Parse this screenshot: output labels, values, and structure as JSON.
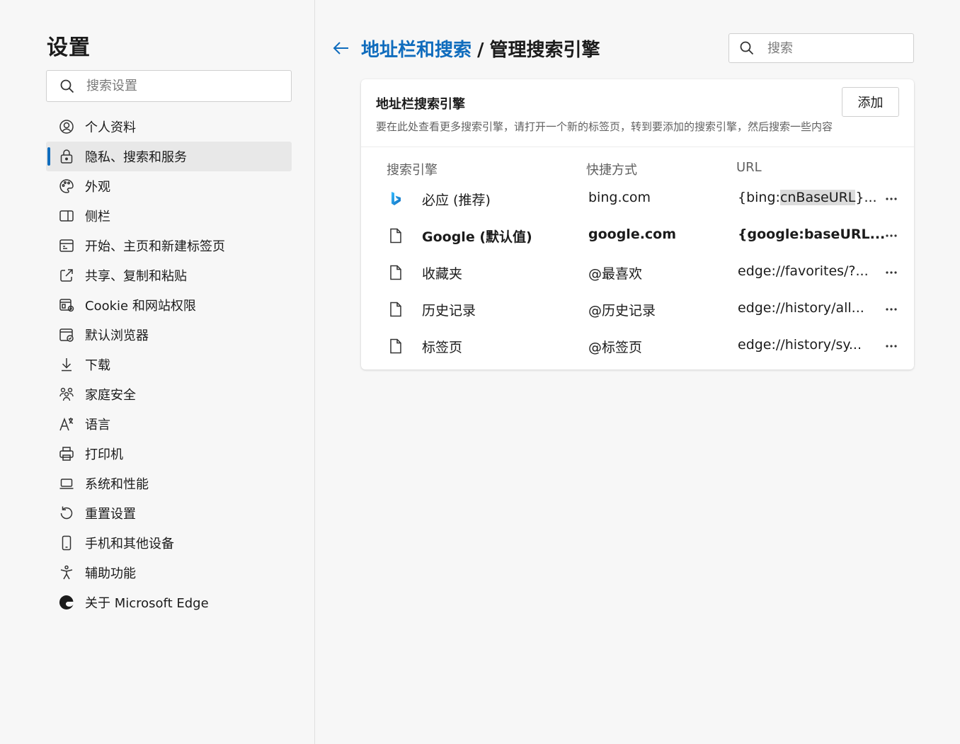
{
  "sidebar": {
    "title": "设置",
    "search_placeholder": "搜索设置",
    "items": [
      {
        "label": "个人资料"
      },
      {
        "label": "隐私、搜索和服务"
      },
      {
        "label": "外观"
      },
      {
        "label": "侧栏"
      },
      {
        "label": "开始、主页和新建标签页"
      },
      {
        "label": "共享、复制和粘贴"
      },
      {
        "label": "Cookie 和网站权限"
      },
      {
        "label": "默认浏览器"
      },
      {
        "label": "下载"
      },
      {
        "label": "家庭安全"
      },
      {
        "label": "语言"
      },
      {
        "label": "打印机"
      },
      {
        "label": "系统和性能"
      },
      {
        "label": "重置设置"
      },
      {
        "label": "手机和其他设备"
      },
      {
        "label": "辅助功能"
      },
      {
        "label": "关于 Microsoft Edge"
      }
    ],
    "active_index": 1
  },
  "header": {
    "breadcrumb_link": "地址栏和搜索",
    "separator": "/",
    "breadcrumb_current": "管理搜索引擎",
    "search_placeholder": "搜索"
  },
  "card": {
    "title": "地址栏搜索引擎",
    "description": "要在此处查看更多搜索引擎，请打开一个新的标签页，转到要添加的搜索引擎，然后搜索一些内容",
    "add_label": "添加",
    "columns": {
      "engine": "搜索引擎",
      "shortcut": "快捷方式",
      "url": "URL"
    },
    "rows": [
      {
        "name": "必应 (推荐)",
        "shortcut": "bing.com",
        "url_pre": "{bing:",
        "url_hl": "cnBaseURL",
        "url_post": "}...",
        "icon": "bing-icon",
        "bold": false
      },
      {
        "name": "Google (默认值)",
        "shortcut": "google.com",
        "url_pre": "{google:baseURL...",
        "url_hl": "",
        "url_post": "",
        "icon": "page-icon",
        "bold": true
      },
      {
        "name": "收藏夹",
        "shortcut": "@最喜欢",
        "url_pre": "edge://favorites/?...",
        "url_hl": "",
        "url_post": "",
        "icon": "page-icon",
        "bold": false
      },
      {
        "name": "历史记录",
        "shortcut": "@历史记录",
        "url_pre": "edge://history/all...",
        "url_hl": "",
        "url_post": "",
        "icon": "page-icon",
        "bold": false
      },
      {
        "name": "标签页",
        "shortcut": "@标签页",
        "url_pre": "edge://history/sy...",
        "url_hl": "",
        "url_post": "",
        "icon": "page-icon",
        "bold": false
      }
    ]
  },
  "colors": {
    "accent": "#0f6cbd",
    "background": "#f7f7f7",
    "card": "#ffffff"
  }
}
